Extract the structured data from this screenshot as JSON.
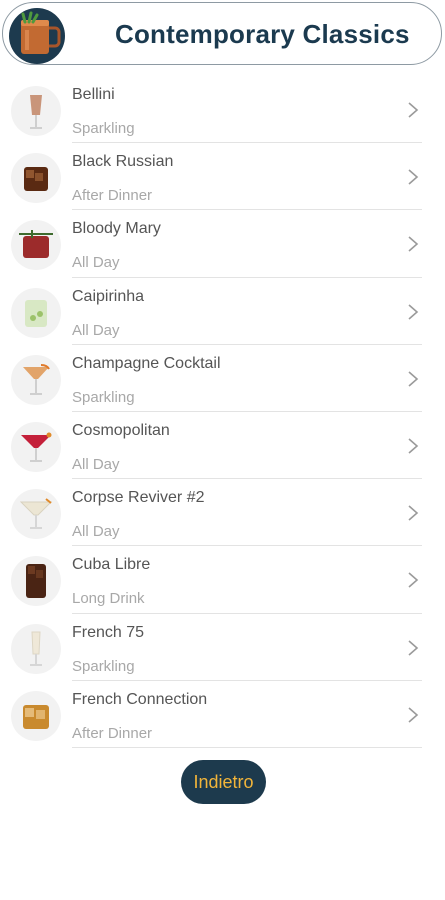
{
  "header": {
    "title": "Contemporary Classics",
    "logo_icon": "copper-mug-icon"
  },
  "cocktails": [
    {
      "name": "Bellini",
      "category": "Sparkling",
      "icon": "bellini-glass-icon",
      "color": "#c9957a"
    },
    {
      "name": "Black Russian",
      "category": "After Dinner",
      "icon": "black-russian-glass-icon",
      "color": "#5a2a12"
    },
    {
      "name": "Bloody Mary",
      "category": "All Day",
      "icon": "bloody-mary-glass-icon",
      "color": "#9c2b2b"
    },
    {
      "name": "Caipirinha",
      "category": "All Day",
      "icon": "caipirinha-glass-icon",
      "color": "#d8e8c4"
    },
    {
      "name": "Champagne Cocktail",
      "category": "Sparkling",
      "icon": "champagne-cocktail-glass-icon",
      "color": "#e2a46a"
    },
    {
      "name": "Cosmopolitan",
      "category": "All Day",
      "icon": "cosmopolitan-glass-icon",
      "color": "#c4203a"
    },
    {
      "name": "Corpse Reviver #2",
      "category": "All Day",
      "icon": "corpse-reviver-glass-icon",
      "color": "#ece6d4"
    },
    {
      "name": "Cuba Libre",
      "category": "Long Drink",
      "icon": "cuba-libre-glass-icon",
      "color": "#4a2414"
    },
    {
      "name": "French 75",
      "category": "Sparkling",
      "icon": "french-75-glass-icon",
      "color": "#efe8d8"
    },
    {
      "name": "French Connection",
      "category": "After Dinner",
      "icon": "french-connection-glass-icon",
      "color": "#c98a2e"
    }
  ],
  "chevron_icon": "chevron-right-icon",
  "back_button": {
    "label": "Indietro"
  },
  "colors": {
    "title": "#1b3a4f",
    "button_bg": "#1d3a4d",
    "button_text": "#f2b53a"
  }
}
